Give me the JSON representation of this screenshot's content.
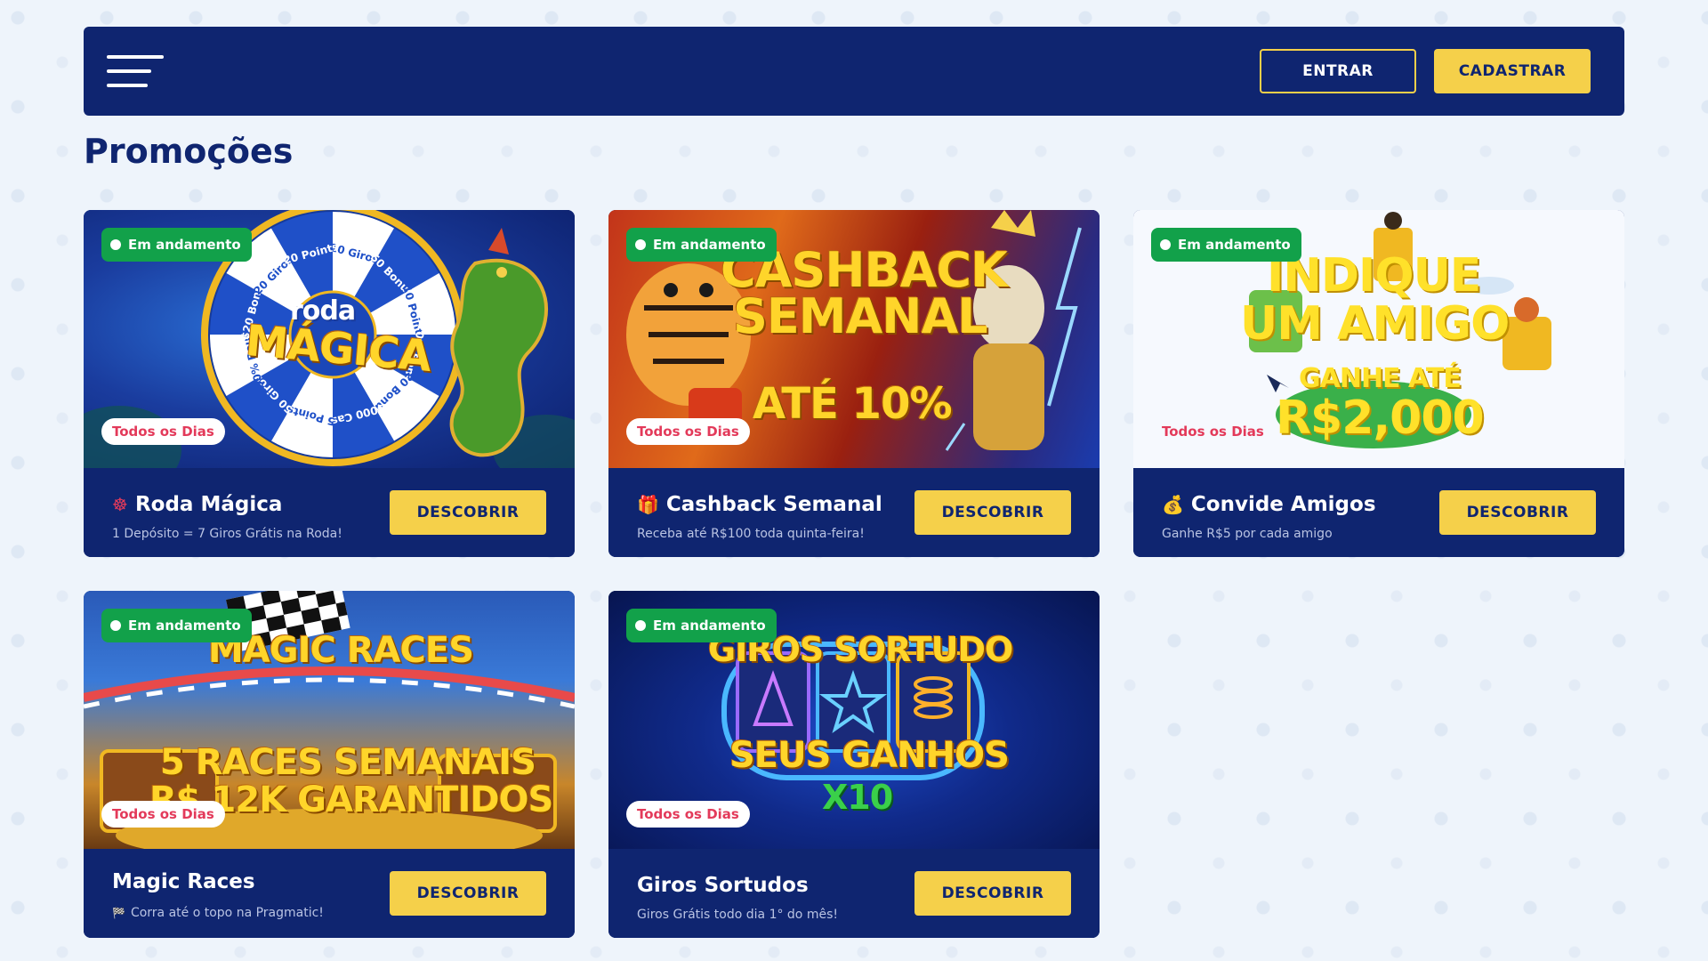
{
  "header": {
    "login_label": "ENTRAR",
    "register_label": "CADASTRAR"
  },
  "page_title": "Promoções",
  "colors": {
    "navy": "#0f2570",
    "gold": "#f5d04a",
    "green_status": "#12a14a",
    "pink_days": "#e33a5a",
    "page_bg": "#eef4fb"
  },
  "promotions": [
    {
      "status": "Em andamento",
      "frequency": "Todos os Dias",
      "icon": "ferris-wheel-icon",
      "icon_glyph": "☸",
      "title": "Roda Mágica",
      "subtitle": "1 Depósito = 7 Giros Grátis na Roda!",
      "button": "DESCOBRIR",
      "banner": {
        "line1": "roda",
        "line2": "MÁGICA",
        "wheel_labels": [
          "10 Giros",
          "50 Bonus",
          "10 Points",
          "20% Bonus",
          "20 Bonus",
          "5000 Cash",
          "5 Points",
          "50 Giros",
          "50% Bonus",
          "R$20 Bonus",
          "20 Giros",
          "20 Points"
        ]
      }
    },
    {
      "status": "Em andamento",
      "frequency": "Todos os Dias",
      "icon": "gift-icon",
      "icon_glyph": "🎁",
      "title": "Cashback Semanal",
      "subtitle": "Receba até R$100 toda quinta-feira!",
      "button": "DESCOBRIR",
      "banner": {
        "line1": "CASHBACK",
        "line2": "SEMANAL",
        "line3": "ATÉ 10%"
      }
    },
    {
      "status": "Em andamento",
      "frequency": "Todos os Dias",
      "icon": "money-bag-icon",
      "icon_glyph": "💰",
      "title": "Convide Amigos",
      "subtitle": "Ganhe R$5 por cada amigo",
      "button": "DESCOBRIR",
      "banner": {
        "line1": "INDIQUE",
        "line2": "UM AMIGO",
        "line3": "GANHE ATÉ",
        "line4": "R$2,000"
      }
    },
    {
      "status": "Em andamento",
      "frequency": "Todos os Dias",
      "icon": "",
      "icon_glyph": "",
      "title": "Magic Races",
      "subtitle": "Corra até o topo na Pragmatic!",
      "subtitle_icon": "checkered-flag-icon",
      "subtitle_icon_glyph": "🏁",
      "button": "DESCOBRIR",
      "banner": {
        "line1": "MAGIC RACES",
        "line2": "5 RACES SEMANAIS",
        "line3": "R$ 12K GARANTIDOS"
      }
    },
    {
      "status": "Em andamento",
      "frequency": "Todos os Dias",
      "icon": "",
      "icon_glyph": "",
      "title": "Giros Sortudos",
      "subtitle": "Giros Grátis todo dia 1° do mês!",
      "button": "DESCOBRIR",
      "banner": {
        "line1": "GIROS SORTUDO",
        "line2": "SEUS GANHOS",
        "line3": "X10"
      }
    }
  ]
}
